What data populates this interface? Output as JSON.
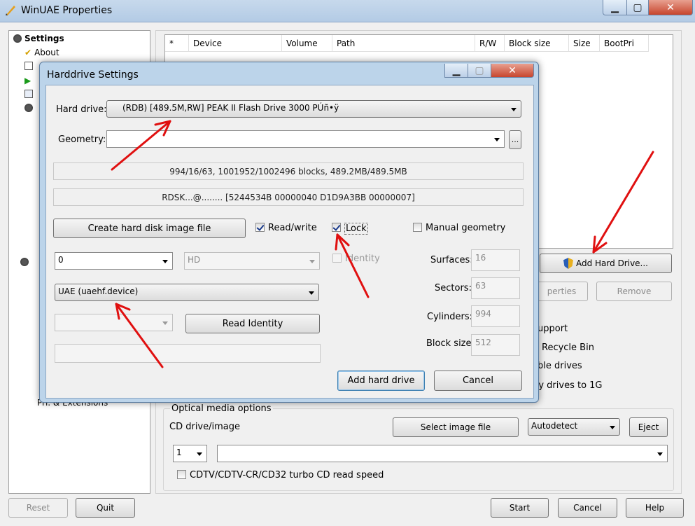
{
  "window": {
    "title": "WinUAE Properties"
  },
  "tree": {
    "items": [
      {
        "label": "Settings",
        "bold": true
      },
      {
        "label": "About"
      },
      {
        "label": "Pri. & Extensions"
      }
    ]
  },
  "hd_table": {
    "columns": [
      "*",
      "Device",
      "Volume",
      "Path",
      "R/W",
      "Block size",
      "Size",
      "BootPri"
    ]
  },
  "main_buttons": {
    "add_hard_drive": "Add Hard Drive...",
    "properties": "perties",
    "remove": "Remove"
  },
  "options_partial": [
    "upport",
    "Recycle Bin",
    "ble drives",
    "ry drives to 1G"
  ],
  "optical": {
    "group_label": "Optical media options",
    "cd_label": "CD drive/image",
    "select_image_button": "Select image file",
    "mode_select": "Autodetect",
    "eject_button": "Eject",
    "unit_select": "1",
    "path_value": "",
    "turbo_label": "CDTV/CDTV-CR/CD32 turbo CD read speed"
  },
  "bottom": {
    "reset": "Reset",
    "quit": "Quit",
    "start": "Start",
    "cancel": "Cancel",
    "help": "Help"
  },
  "dialog": {
    "title": "Harddrive Settings",
    "hard_drive_label": "Hard drive:",
    "hard_drive_value": "(RDB) [489.5M,RW] PEAK II Flash Drive 3000 PÚñ•ÿ",
    "geometry_label": "Geometry:",
    "geometry_value": "",
    "geometry_browse": "...",
    "info_line1": "994/16/63, 1001952/1002496 blocks, 489.2MB/489.5MB",
    "info_line2": "RDSK...@........ [5244534B 00000040 D1D9A3BB 00000007]",
    "create_image_button": "Create hard disk image file",
    "read_write_label": "Read/write",
    "read_write_checked": true,
    "lock_label": "Lock",
    "lock_checked": true,
    "manual_geometry_label": "Manual geometry",
    "manual_geometry_checked": false,
    "controller_unit": "0",
    "controller_type": "HD",
    "identity_label": "Identity",
    "device_select": "UAE (uaehf.device)",
    "read_identity_button": "Read Identity",
    "surfaces_label": "Surfaces:",
    "surfaces_value": "16",
    "sectors_label": "Sectors:",
    "sectors_value": "63",
    "cylinders_label": "Cylinders:",
    "cylinders_value": "994",
    "block_size_label": "Block size:",
    "block_size_value": "512",
    "add_button": "Add hard drive",
    "cancel_button": "Cancel"
  },
  "colors": {
    "titlebar": "#b3cbe5",
    "close_button": "#c7452d",
    "annotation_arrow": "#e01010"
  }
}
